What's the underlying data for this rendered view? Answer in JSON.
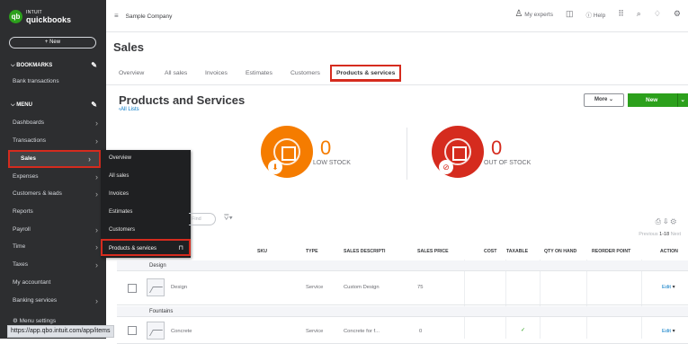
{
  "app": {
    "logo_top": "INTUIT",
    "logo_main": "quickbooks",
    "new_button": "+ New",
    "status_url": "https://app.qbo.intuit.com/app/items"
  },
  "sidebar": {
    "bookmarks_label": "BOOKMARKS",
    "bank_transactions": "Bank transactions",
    "menu_label": "MENU",
    "items": [
      {
        "label": "Dashboards"
      },
      {
        "label": "Transactions"
      },
      {
        "label": "Sales"
      },
      {
        "label": "Expenses"
      },
      {
        "label": "Customers & leads"
      },
      {
        "label": "Reports"
      },
      {
        "label": "Payroll"
      },
      {
        "label": "Time"
      },
      {
        "label": "Taxes"
      },
      {
        "label": "My accountant"
      },
      {
        "label": "Banking services"
      }
    ],
    "menu_settings": "Menu settings"
  },
  "submenu": {
    "items": [
      {
        "label": "Overview"
      },
      {
        "label": "All sales"
      },
      {
        "label": "Invoices"
      },
      {
        "label": "Estimates"
      },
      {
        "label": "Customers"
      },
      {
        "label": "Products & services"
      }
    ]
  },
  "topbar": {
    "company": "Sample Company",
    "my_experts": "My experts",
    "help": "Help"
  },
  "page": {
    "title": "Sales"
  },
  "tabs": [
    {
      "label": "Overview"
    },
    {
      "label": "All sales"
    },
    {
      "label": "Invoices"
    },
    {
      "label": "Estimates"
    },
    {
      "label": "Customers"
    },
    {
      "label": "Products & services"
    }
  ],
  "products": {
    "title": "Products and Services",
    "all_lists": "All Lists",
    "more_button": "More",
    "new_button": "New",
    "low_stock": {
      "count": "0",
      "label": "LOW STOCK",
      "color": "#f57c00"
    },
    "out_of_stock": {
      "count": "0",
      "label": "OUT OF STOCK",
      "color": "#d52b1e"
    },
    "filter_placeholder": "Find",
    "pager": {
      "prev": "Previous",
      "range": "1-18",
      "next": "Next"
    }
  },
  "table": {
    "headers": {
      "sku": "SKU",
      "type": "TYPE",
      "sales_description": "SALES DESCRIPTI",
      "sales_price": "SALES PRICE",
      "cost": "COST",
      "taxable": "TAXABLE",
      "qty_on_hand": "QTY ON HAND",
      "reorder_point": "REORDER POINT",
      "action": "ACTION"
    },
    "groups": [
      {
        "name": "Design",
        "rows": [
          {
            "name": "Design",
            "type": "Service",
            "description": "Custom Design",
            "price": "75",
            "taxable": "",
            "action": "Edit"
          }
        ]
      },
      {
        "name": "Fountains",
        "rows": [
          {
            "name": "Concrete",
            "type": "Service",
            "description": "Concrete for f...",
            "price": "0",
            "taxable": "✓",
            "action": "Edit"
          }
        ]
      }
    ]
  }
}
